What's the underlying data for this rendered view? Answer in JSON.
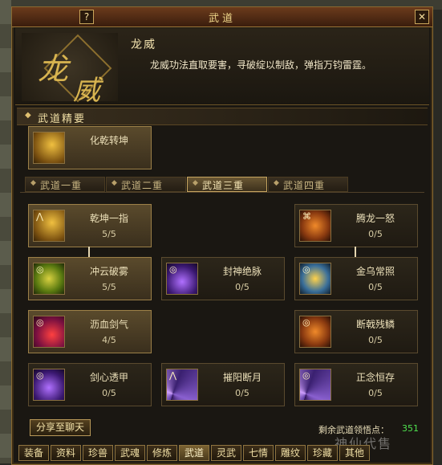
{
  "window": {
    "title": "武道",
    "help_label": "?",
    "close_label": "✕"
  },
  "header": {
    "emblem_chars": [
      "龙",
      "威"
    ],
    "skill_name": "龙威",
    "skill_desc": "龙威功法直取要害，寻破绽以制敌，弹指万钧雷霆。"
  },
  "essence": {
    "section_label": "武道精要",
    "card": {
      "name": "化乾转坤",
      "icon": "gauntlet-icon"
    }
  },
  "tabs": [
    {
      "label": "武道一重",
      "active": false
    },
    {
      "label": "武道二重",
      "active": false
    },
    {
      "label": "武道三重",
      "active": true
    },
    {
      "label": "武道四重",
      "active": false
    }
  ],
  "skills": [
    {
      "name": "乾坤一指",
      "level": "5/5",
      "icon": "finger-strike-icon",
      "lit": true
    },
    {
      "name": "腾龙一怒",
      "level": "0/5",
      "icon": "dragon-fury-icon",
      "lit": false
    },
    {
      "name": "冲云破雾",
      "level": "5/5",
      "icon": "cloud-burst-icon",
      "lit": true
    },
    {
      "name": "封神绝脉",
      "level": "0/5",
      "icon": "seal-meridian-icon",
      "lit": false
    },
    {
      "name": "金乌常照",
      "level": "0/5",
      "icon": "golden-crow-icon",
      "lit": false
    },
    {
      "name": "沥血剑气",
      "level": "4/5",
      "icon": "blood-sword-icon",
      "lit": true
    },
    {
      "name": "断戟残鳞",
      "level": "0/5",
      "icon": "broken-halberd-icon",
      "lit": false
    },
    {
      "name": "剑心透甲",
      "level": "0/5",
      "icon": "piercing-sword-icon",
      "lit": false
    },
    {
      "name": "摧阳断月",
      "level": "0/5",
      "icon": "sun-moon-icon",
      "lit": false
    },
    {
      "name": "正念恒存",
      "level": "0/5",
      "icon": "mind-eternal-icon",
      "lit": false
    }
  ],
  "footer": {
    "share_label": "分享至聊天",
    "points_label": "剩余武道领悟点：",
    "points_value": "351"
  },
  "bottom_tabs": [
    "装备",
    "资料",
    "珍兽",
    "武魂",
    "修炼",
    "武道",
    "灵武",
    "七情",
    "雕纹",
    "珍藏",
    "其他"
  ],
  "bottom_tab_active": "武道",
  "watermark": "神仙代售"
}
